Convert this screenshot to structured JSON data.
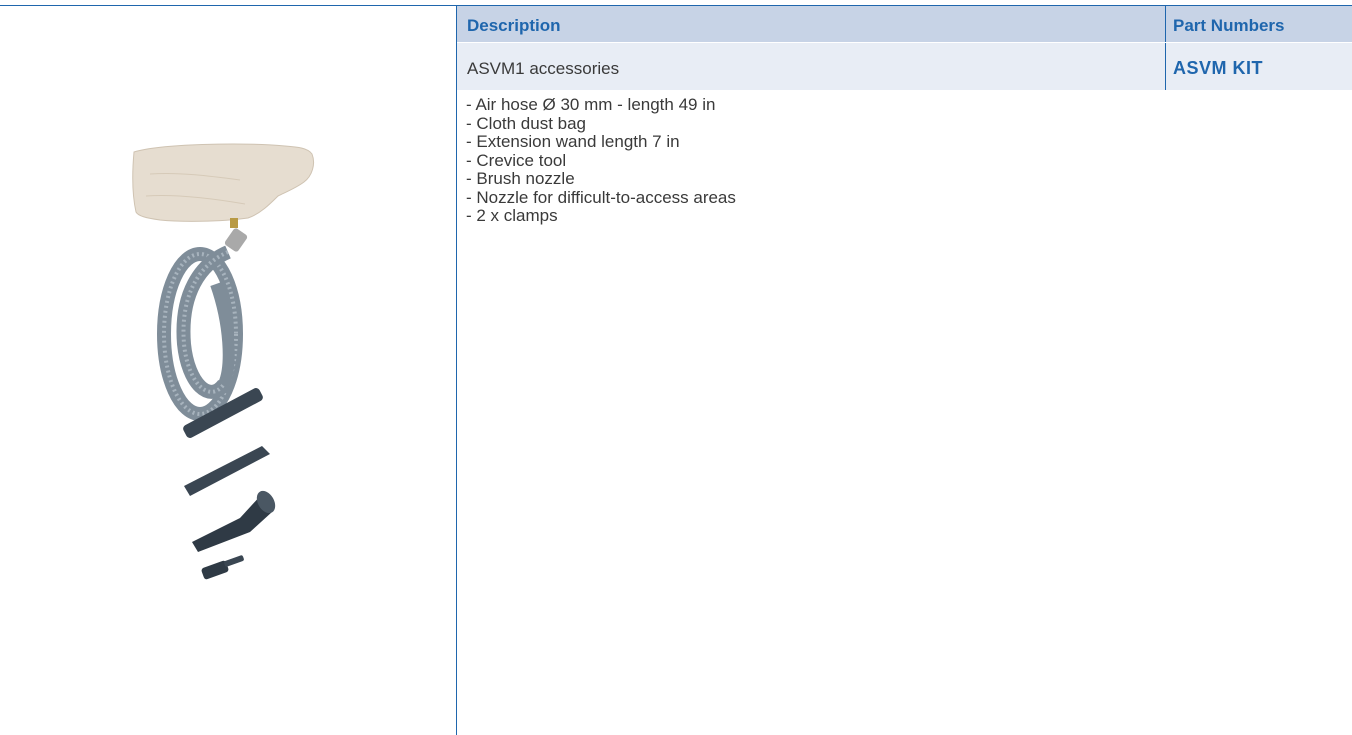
{
  "table": {
    "header": {
      "description": "Description",
      "part_numbers": "Part Numbers"
    },
    "row": {
      "description": "ASVM1 accessories",
      "part_number": "ASVM KIT"
    },
    "features": [
      "- Air hose Ø 30 mm - length 49 in",
      "- Cloth dust bag",
      "- Extension wand length 7 in",
      "- Crevice tool",
      "- Brush nozzle",
      "- Nozzle for difficult-to-access areas",
      "- 2 x clamps"
    ]
  },
  "colors": {
    "accent": "#1f66ad",
    "header_bg": "#c7d3e6",
    "row_bg": "#e8edf5",
    "text": "#3a3a3a"
  }
}
